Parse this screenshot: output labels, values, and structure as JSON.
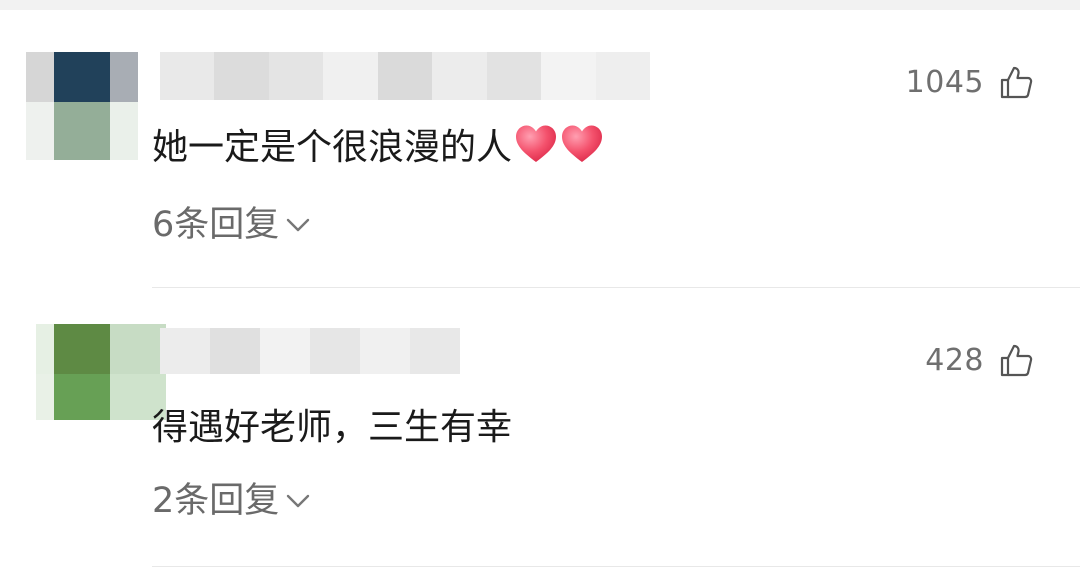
{
  "comments": [
    {
      "text": "她一定是个很浪漫的人",
      "emojis": [
        "heart-emoji",
        "heart-emoji"
      ],
      "likes": "1045",
      "replies_label": "6条回复",
      "avatar_colors": [
        "#d6d6d6",
        "#21415a",
        "#a8adb4",
        "#eef1ee",
        "#94ae98",
        "#eaf0ea"
      ],
      "name_colors": [
        "#e9e9e9",
        "#dcdcdc",
        "#e4e4e4",
        "#f0f0f0",
        "#dadada",
        "#ececec",
        "#e2e2e2",
        "#f3f3f3",
        "#eeeeee"
      ]
    },
    {
      "text": "得遇好老师，三生有幸",
      "likes": "428",
      "replies_label": "2条回复",
      "avatar_colors": [
        "#e6f0e4",
        "#5e8a44",
        "#c7dcc4",
        "#e9f1e7",
        "#67a055",
        "#cfe3cc"
      ],
      "name_colors": [
        "#ececec",
        "#e0e0e0",
        "#f2f2f2",
        "#e6e6e6",
        "#f0f0f0",
        "#e8e8e8"
      ]
    }
  ],
  "colors": {
    "heart": "#f0506a",
    "text": "#1a1a1a",
    "secondary": "#6a6a6a"
  }
}
